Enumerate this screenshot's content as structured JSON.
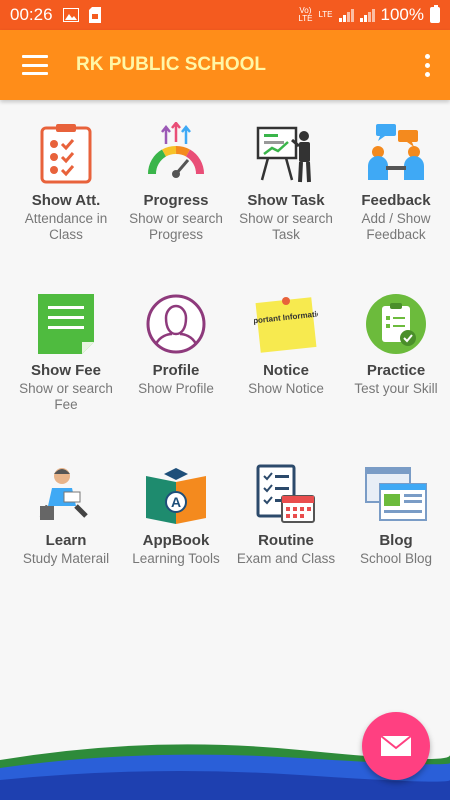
{
  "status_bar": {
    "time": "00:26",
    "battery": "100%",
    "network": "LTE"
  },
  "app_bar": {
    "title": "RK PUBLIC SCHOOL"
  },
  "tiles": [
    {
      "title": "Show Att.",
      "subtitle": "Attendance in Class"
    },
    {
      "title": "Progress",
      "subtitle": "Show or search Progress"
    },
    {
      "title": "Show Task",
      "subtitle": "Show or search Task"
    },
    {
      "title": "Feedback",
      "subtitle": "Add / Show Feedback"
    },
    {
      "title": "Show Fee",
      "subtitle": "Show or search Fee"
    },
    {
      "title": "Profile",
      "subtitle": "Show Profile"
    },
    {
      "title": "Notice",
      "subtitle": "Show Notice"
    },
    {
      "title": "Practice",
      "subtitle": "Test your Skill"
    },
    {
      "title": "Learn",
      "subtitle": "Study Materail"
    },
    {
      "title": "AppBook",
      "subtitle": "Learning Tools"
    },
    {
      "title": "Routine",
      "subtitle": "Exam and Class"
    },
    {
      "title": "Blog",
      "subtitle": "School Blog"
    }
  ],
  "notice_icon_text": "Important Information",
  "colors": {
    "status_bar": "#f45b1f",
    "app_bar": "#ff8d19",
    "title": "#fff6a6",
    "fab": "#ff4081"
  }
}
